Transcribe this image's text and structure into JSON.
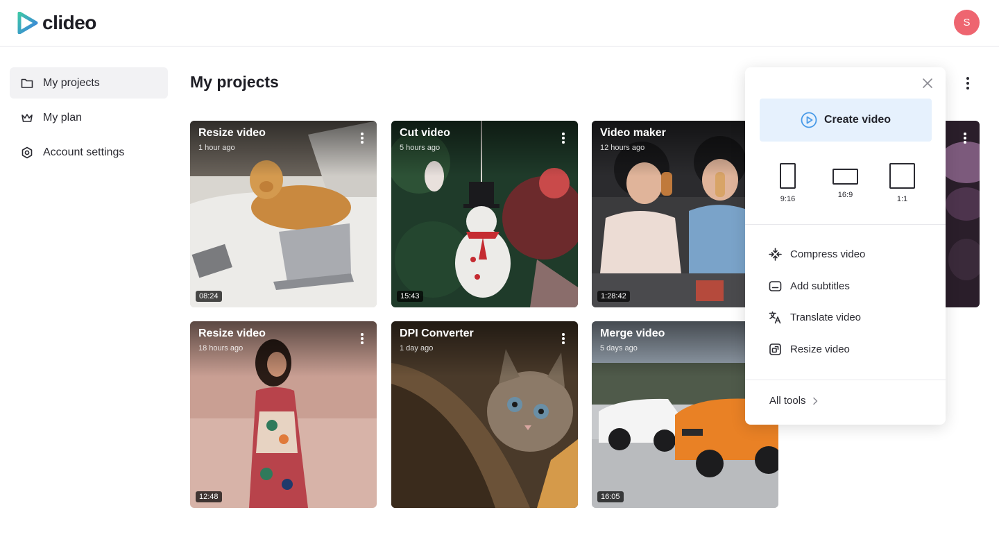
{
  "header": {
    "logo_text": "clideo",
    "avatar_initial": "S"
  },
  "sidebar": {
    "items": [
      {
        "label": "My projects",
        "icon": "folder-icon",
        "active": true
      },
      {
        "label": "My plan",
        "icon": "crown-icon",
        "active": false
      },
      {
        "label": "Account settings",
        "icon": "gear-icon",
        "active": false
      }
    ]
  },
  "main": {
    "title": "My projects"
  },
  "projects": [
    {
      "title": "Resize video",
      "time": "1 hour ago",
      "duration": "08:24",
      "scene": "dog-on-bed"
    },
    {
      "title": "Cut video",
      "time": "5 hours ago",
      "duration": "15:43",
      "scene": "snowman-ornament"
    },
    {
      "title": "Video maker",
      "time": "12 hours ago",
      "duration": "1:28:42",
      "scene": "kids-with-popsicles"
    },
    {
      "title": "Resize video",
      "time": "18 hours ago",
      "duration": "12:48",
      "scene": "woman-in-dress"
    },
    {
      "title": "DPI Converter",
      "time": "1 day ago",
      "duration": "",
      "scene": "cat-peeking"
    },
    {
      "title": "Merge video",
      "time": "5 days ago",
      "duration": "16:05",
      "scene": "sports-cars"
    }
  ],
  "dropdown": {
    "create_label": "Create video",
    "ratios": [
      {
        "label": "9:16"
      },
      {
        "label": "16:9"
      },
      {
        "label": "1:1"
      }
    ],
    "tools": [
      {
        "label": "Compress video",
        "icon": "compress-icon"
      },
      {
        "label": "Add subtitles",
        "icon": "subtitles-icon"
      },
      {
        "label": "Translate video",
        "icon": "translate-icon"
      },
      {
        "label": "Resize video",
        "icon": "resize-icon"
      }
    ],
    "all_tools_label": "All tools"
  },
  "colors": {
    "accent": "#4a9be8",
    "avatar": "#ee6570",
    "create_bg": "#e6f1fd",
    "active_nav": "#f2f2f4"
  }
}
